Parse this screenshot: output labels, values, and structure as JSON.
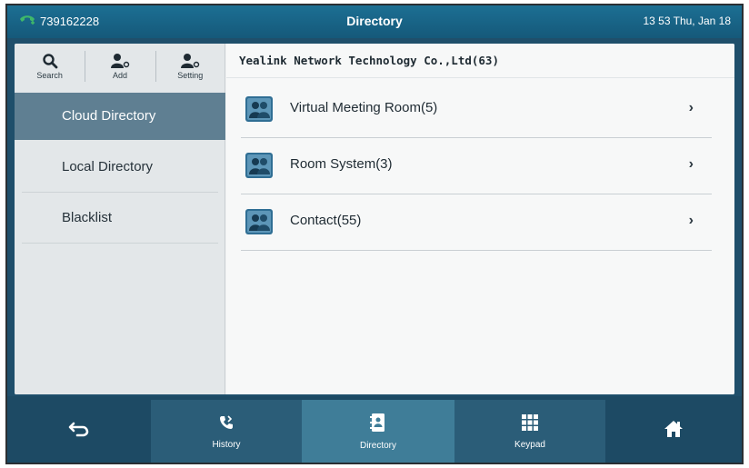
{
  "status": {
    "phone_number": "739162228",
    "title": "Directory",
    "datetime": "13 53 Thu, Jan 18"
  },
  "toolbar": {
    "search_label": "Search",
    "add_label": "Add",
    "setting_label": "Setting"
  },
  "sidebar": {
    "items": [
      {
        "label": "Cloud Directory",
        "active": true
      },
      {
        "label": "Local Directory",
        "active": false
      },
      {
        "label": "Blacklist",
        "active": false
      }
    ]
  },
  "main": {
    "header": "Yealink Network Technology Co.,Ltd(63)",
    "rows": [
      {
        "label": "Virtual Meeting Room(5)"
      },
      {
        "label": "Room System(3)"
      },
      {
        "label": "Contact(55)"
      }
    ]
  },
  "bottom_nav": {
    "history_label": "History",
    "directory_label": "Directory",
    "keypad_label": "Keypad"
  },
  "colors": {
    "statusbar": "#1c6f93",
    "active_item": "#5f7f92",
    "bottombar": "#1d4a64",
    "active_nav": "#3f7d98",
    "handset_icon": "#3fb86a"
  }
}
